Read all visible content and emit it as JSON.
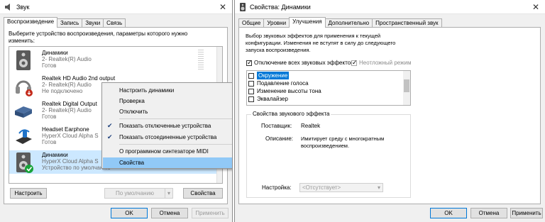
{
  "left_window": {
    "title": "Звук",
    "close_glyph": "✕",
    "tabs": [
      "Воспроизведение",
      "Запись",
      "Звуки",
      "Связь"
    ],
    "instruction": "Выберите устройство воспроизведения, параметры которого нужно изменить:",
    "devices": [
      {
        "name": "Динамики",
        "driver": "2- Realtek(R) Audio",
        "status": "Готов",
        "icon": "speaker-icon"
      },
      {
        "name": "Realtek HD Audio 2nd output",
        "driver": "2- Realtek(R) Audio",
        "status": "Не подключено",
        "icon": "headphones-icon"
      },
      {
        "name": "Realtek Digital Output",
        "driver": "2- Realtek(R) Audio",
        "status": "Готов",
        "icon": "digital-output-icon"
      },
      {
        "name": "Headset Earphone",
        "driver": "HyperX Cloud Alpha S",
        "status": "Готов",
        "icon": "headset-icon"
      },
      {
        "name": "Динамики",
        "driver": "HyperX Cloud Alpha S",
        "status": "Устройство по умолчанию",
        "icon": "speaker-default-icon"
      }
    ],
    "context_menu": [
      {
        "label": "Настроить динамики",
        "checked": false
      },
      {
        "label": "Проверка",
        "checked": false
      },
      {
        "label": "Отключить",
        "checked": false
      },
      {
        "label": "Показать отключенные устройства",
        "checked": true
      },
      {
        "label": "Показать отсоединенные устройства",
        "checked": true
      },
      {
        "label": "О программном синтезаторе MIDI",
        "checked": false
      },
      {
        "label": "Свойства",
        "checked": false,
        "highlighted": true
      }
    ],
    "buttons": {
      "configure": "Настроить",
      "default": "По умолчанию",
      "properties": "Свойства",
      "ok": "OK",
      "cancel": "Отмена",
      "apply": "Применить"
    }
  },
  "right_window": {
    "title": "Свойства: Динамики",
    "close_glyph": "✕",
    "tabs": [
      "Общие",
      "Уровни",
      "Улучшения",
      "Дополнительно",
      "Пространственный звук"
    ],
    "active_tab": "Улучшения",
    "description": "Выбор звуковых эффектов для применения к текущей конфигурации. Изменения не вступят в силу до следующего запуска воспроизведения.",
    "disable_all_label": "Отключение всех звуковых эффектов",
    "immediate_mode_label": "Неотложный режим",
    "effects": [
      "Окружение",
      "Подавление голоса",
      "Изменение высоты тона",
      "Эквалайзер"
    ],
    "properties_group": "Свойства звукового эффекта",
    "provider_label": "Поставщик:",
    "provider_value": "Realtek",
    "description_label": "Описание:",
    "description_value": "Имитирует среду с многократным воспроизведением.",
    "setting_label": "Настройка:",
    "setting_value": "<Отсутствует>",
    "buttons": {
      "ok": "OK",
      "cancel": "Отмена",
      "apply": "Применить"
    }
  }
}
